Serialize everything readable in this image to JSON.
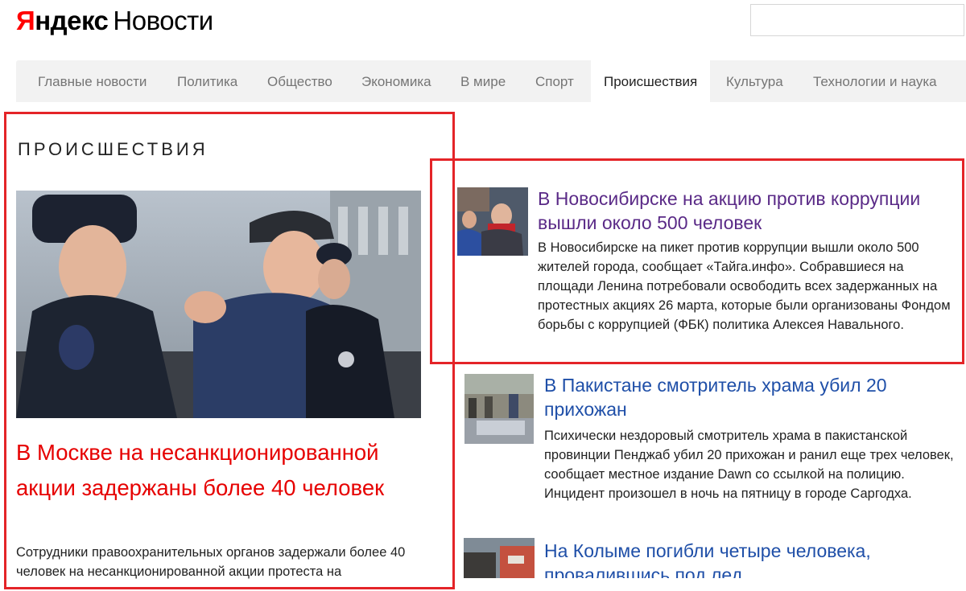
{
  "header": {
    "logo_ya": "Я",
    "logo_ndex": "ндекс",
    "logo_novosti": "Новости",
    "search_value": ""
  },
  "nav": {
    "items": [
      {
        "label": "Главные новости"
      },
      {
        "label": "Политика"
      },
      {
        "label": "Общество"
      },
      {
        "label": "Экономика"
      },
      {
        "label": "В мире"
      },
      {
        "label": "Спорт"
      },
      {
        "label": "Происшествия",
        "active": true
      },
      {
        "label": "Культура"
      },
      {
        "label": "Технологии и наука"
      }
    ]
  },
  "section": {
    "title": "ПРОИСШЕСТВИЯ",
    "main": {
      "headline": "В Москве на несанкционированной акции задержаны более 40 человек",
      "snippet": "Сотрудники правоохранительных органов задержали более 40 человек на несанкционированной акции протеста на"
    },
    "stories": [
      {
        "title": "В Новосибирске на акцию против коррупции вышли около 500 человек",
        "text": "В Новосибирске на пикет против коррупции вышли около 500 жителей города, сообщает «Тайга.инфо». Собравшиеся на площади Ленина потребовали освободить всех задержанных на протестных акциях 26 марта, которые были организованы Фондом борьбы с коррупцией (ФБК) политика Алексея Навального."
      },
      {
        "title": "В Пакистане смотритель храма убил 20 прихожан",
        "text": "Психически нездоровый смотритель храма в пакистанской провинции Пенджаб убил 20 прихожан и ранил еще трех человек, сообщает местное издание Dawn со ссылкой на полицию. Инцидент произошел в ночь на пятницу в городе Саргодха."
      },
      {
        "title": "На Колыме погибли четыре человека, провалившись под лед",
        "text": ""
      }
    ]
  },
  "colors": {
    "brand_red": "#ff0000",
    "headline_red": "#e60000",
    "link_blue": "#1f4fa8",
    "visited_purple": "#5a2a87",
    "highlight_box": "#e42428"
  }
}
